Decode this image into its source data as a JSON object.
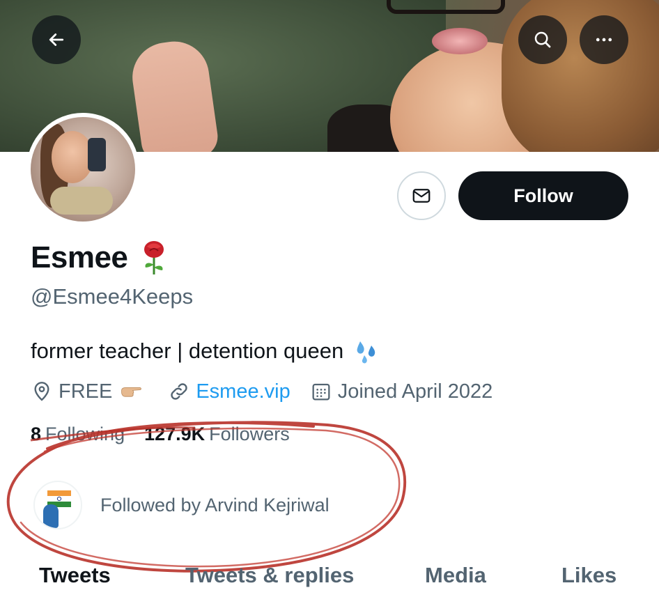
{
  "header": {
    "back_icon": "arrow-left-icon",
    "search_icon": "search-icon",
    "more_icon": "more-horizontal-icon"
  },
  "profile": {
    "display_name": "Esmee",
    "name_emoji": "rose",
    "handle": "@Esmee4Keeps",
    "bio": "former teacher | detention queen",
    "bio_emoji": "sweat-droplets",
    "location": "FREE",
    "location_emoji": "backhand-index-pointing-right",
    "website": "Esmee.vip",
    "joined": "Joined April 2022",
    "following_count": "8",
    "following_label": "Following",
    "followers_count": "127.9K",
    "followers_label": "Followers",
    "followed_by": "Followed by Arvind Kejriwal"
  },
  "actions": {
    "message_icon": "envelope-icon",
    "follow_label": "Follow"
  },
  "tabs": [
    {
      "label": "Tweets",
      "active": true
    },
    {
      "label": "Tweets & replies",
      "active": false
    },
    {
      "label": "Media",
      "active": false
    },
    {
      "label": "Likes",
      "active": false
    }
  ],
  "colors": {
    "text_primary": "#0f1419",
    "text_secondary": "#536471",
    "link": "#1d9bf0",
    "annotation_red": "#b8322a"
  }
}
